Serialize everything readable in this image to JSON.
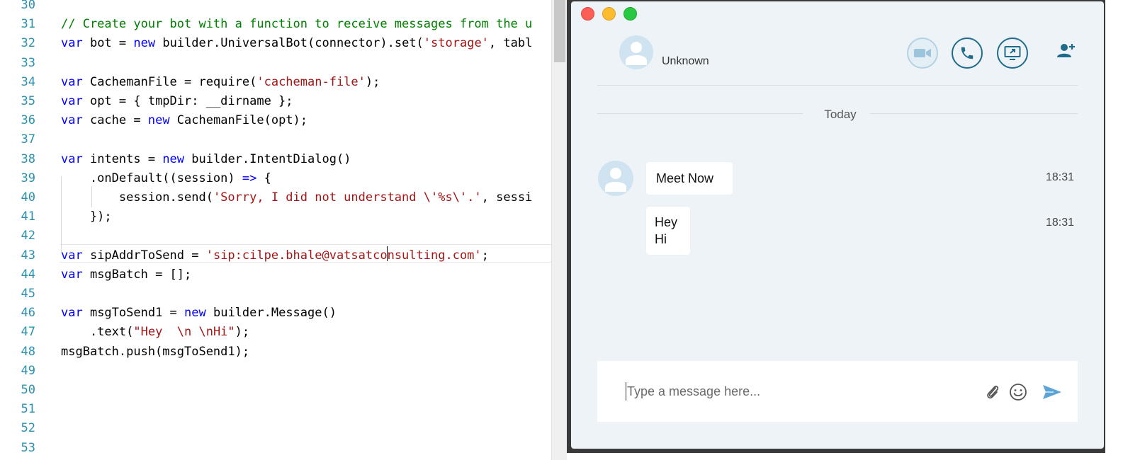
{
  "editor": {
    "lines": [
      {
        "number": "30",
        "tokens": []
      },
      {
        "number": "31",
        "tokens": [
          {
            "t": "// Create your bot with a function to receive messages from the ",
            "c": "cm"
          },
          {
            "t": "u",
            "c": "cm"
          }
        ]
      },
      {
        "number": "32",
        "tokens": [
          {
            "t": "var",
            "c": "kw"
          },
          {
            "t": " bot = ",
            "c": "plain"
          },
          {
            "t": "new",
            "c": "kw"
          },
          {
            "t": " builder.UniversalBot(connector).set(",
            "c": "plain"
          },
          {
            "t": "'storage'",
            "c": "str"
          },
          {
            "t": ", tabl",
            "c": "plain"
          }
        ]
      },
      {
        "number": "33",
        "tokens": []
      },
      {
        "number": "34",
        "tokens": [
          {
            "t": "var",
            "c": "kw"
          },
          {
            "t": " CachemanFile = require(",
            "c": "plain"
          },
          {
            "t": "'cacheman-file'",
            "c": "str"
          },
          {
            "t": ");",
            "c": "plain"
          }
        ]
      },
      {
        "number": "35",
        "tokens": [
          {
            "t": "var",
            "c": "kw"
          },
          {
            "t": " opt = { tmpDir: __dirname };",
            "c": "plain"
          }
        ]
      },
      {
        "number": "36",
        "tokens": [
          {
            "t": "var",
            "c": "kw"
          },
          {
            "t": " cache = ",
            "c": "plain"
          },
          {
            "t": "new",
            "c": "kw"
          },
          {
            "t": " CachemanFile(opt);",
            "c": "plain"
          }
        ]
      },
      {
        "number": "37",
        "tokens": []
      },
      {
        "number": "38",
        "tokens": [
          {
            "t": "var",
            "c": "kw"
          },
          {
            "t": " intents = ",
            "c": "plain"
          },
          {
            "t": "new",
            "c": "kw"
          },
          {
            "t": " builder.IntentDialog()",
            "c": "plain"
          }
        ]
      },
      {
        "number": "39",
        "tokens": [
          {
            "t": "    .onDefault((session) ",
            "c": "plain"
          },
          {
            "t": "=>",
            "c": "kw"
          },
          {
            "t": " {",
            "c": "plain"
          }
        ]
      },
      {
        "number": "40",
        "tokens": [
          {
            "t": "        session.send(",
            "c": "plain"
          },
          {
            "t": "'Sorry, I did not understand \\'%s\\'.'",
            "c": "str"
          },
          {
            "t": ", sessi",
            "c": "plain"
          }
        ]
      },
      {
        "number": "41",
        "tokens": [
          {
            "t": "    });",
            "c": "plain"
          }
        ]
      },
      {
        "number": "42",
        "tokens": []
      },
      {
        "number": "43",
        "tokens": [
          {
            "t": "var",
            "c": "kw"
          },
          {
            "t": " sipAddrToSend = ",
            "c": "plain"
          },
          {
            "t": "'sip:cilpe.bhale@vatsatconsulting.com'",
            "c": "str"
          },
          {
            "t": ";",
            "c": "plain"
          }
        ]
      },
      {
        "number": "44",
        "tokens": [
          {
            "t": "var",
            "c": "kw"
          },
          {
            "t": " msgBatch = [];",
            "c": "plain"
          }
        ]
      },
      {
        "number": "45",
        "tokens": []
      },
      {
        "number": "46",
        "tokens": [
          {
            "t": "var",
            "c": "kw"
          },
          {
            "t": " msgToSend1 = ",
            "c": "plain"
          },
          {
            "t": "new",
            "c": "kw"
          },
          {
            "t": " builder.Message()",
            "c": "plain"
          }
        ]
      },
      {
        "number": "47",
        "tokens": [
          {
            "t": "    .text(",
            "c": "plain"
          },
          {
            "t": "\"Hey  \\n \\nHi\"",
            "c": "str"
          },
          {
            "t": ");",
            "c": "plain"
          }
        ]
      },
      {
        "number": "48",
        "tokens": [
          {
            "t": "msgBatch.push(msgToSend1);",
            "c": "plain"
          }
        ]
      },
      {
        "number": "49",
        "tokens": []
      },
      {
        "number": "50",
        "tokens": []
      },
      {
        "number": "51",
        "tokens": []
      },
      {
        "number": "52",
        "tokens": []
      },
      {
        "number": "53",
        "tokens": []
      }
    ]
  },
  "chat": {
    "contact_name": "Unknown",
    "date_divider": "Today",
    "messages": [
      {
        "text": "Meet Now",
        "time": "18:31"
      },
      {
        "lines": [
          "Hey",
          "Hi"
        ],
        "time": "18:31"
      }
    ],
    "composer": {
      "placeholder": "Type a message here..."
    },
    "colors": {
      "accent": "#1f6b8c",
      "avatar_bg": "#cfe3f0",
      "window_bg": "#eef3f8",
      "send_icon": "#5aa4d6"
    },
    "icons": [
      "video-camera-icon",
      "phone-icon",
      "share-screen-icon",
      "add-contact-icon",
      "paperclip-icon",
      "emoji-icon",
      "send-icon"
    ]
  }
}
